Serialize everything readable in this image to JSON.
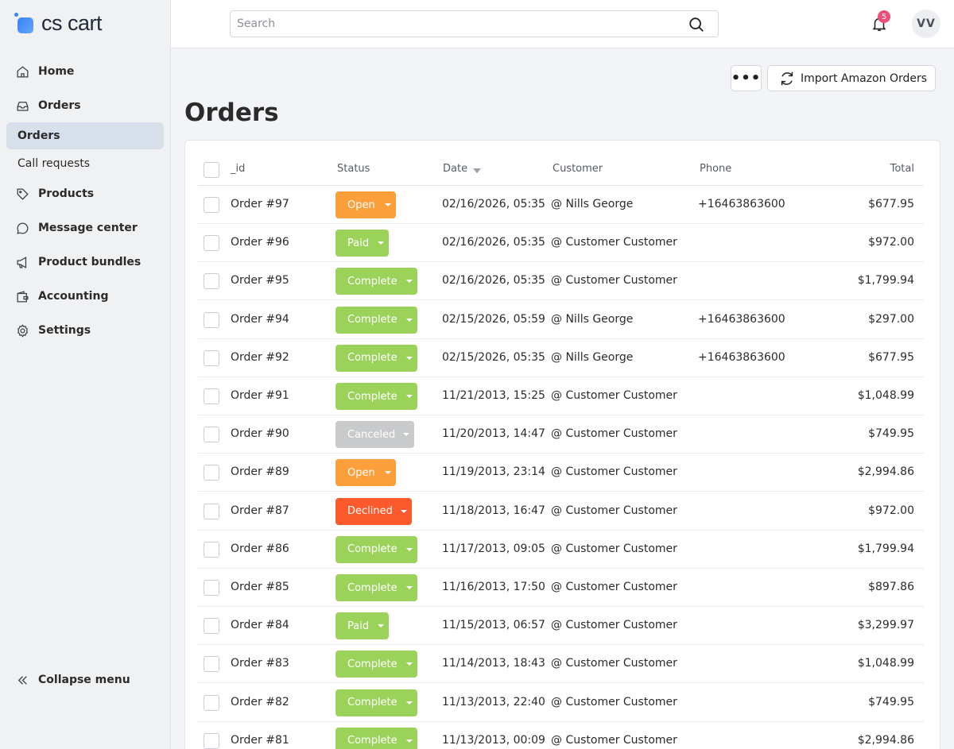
{
  "app": {
    "logo_text": "cs cart"
  },
  "sidebar": {
    "items": [
      {
        "label": "Home",
        "icon": "home-icon"
      },
      {
        "label": "Orders",
        "icon": "inbox-icon"
      },
      {
        "label": "Products",
        "icon": "tag-icon"
      },
      {
        "label": "Message center",
        "icon": "message-icon"
      },
      {
        "label": "Product bundles",
        "icon": "megaphone-icon"
      },
      {
        "label": "Accounting",
        "icon": "wallet-icon"
      },
      {
        "label": "Settings",
        "icon": "gear-icon"
      }
    ],
    "subitems": [
      {
        "label": "Orders",
        "active": true
      },
      {
        "label": "Call requests",
        "active": false
      }
    ],
    "collapse_label": "Collapse menu"
  },
  "topbar": {
    "search_placeholder": "Search",
    "notifications_count": "5",
    "avatar_initials": "VV"
  },
  "page": {
    "title": "Orders",
    "more_label": "•••",
    "import_label": "Import Amazon Orders"
  },
  "table": {
    "headers": {
      "id": "_id",
      "status": "Status",
      "date": "Date",
      "customer": "Customer",
      "phone": "Phone",
      "total": "Total"
    },
    "status_colors": {
      "Open": "#fd9f3a",
      "Paid": "#9bd35a",
      "Complete": "#9bd35a",
      "Canceled": "#c9cacc",
      "Declined": "#fc5a2c"
    },
    "rows": [
      {
        "id": "Order #97",
        "status": "Open",
        "date": "02/16/2026, 05:35",
        "customer": "@ Nills George",
        "phone": "+16463863600",
        "total": "$677.95"
      },
      {
        "id": "Order #96",
        "status": "Paid",
        "date": "02/16/2026, 05:35",
        "customer": "@ Customer Customer",
        "phone": "",
        "total": "$972.00"
      },
      {
        "id": "Order #95",
        "status": "Complete",
        "date": "02/16/2026, 05:35",
        "customer": "@ Customer Customer",
        "phone": "",
        "total": "$1,799.94"
      },
      {
        "id": "Order #94",
        "status": "Complete",
        "date": "02/15/2026, 05:59",
        "customer": "@ Nills George",
        "phone": "+16463863600",
        "total": "$297.00"
      },
      {
        "id": "Order #92",
        "status": "Complete",
        "date": "02/15/2026, 05:35",
        "customer": "@ Nills George",
        "phone": "+16463863600",
        "total": "$677.95"
      },
      {
        "id": "Order #91",
        "status": "Complete",
        "date": "11/21/2013, 15:25",
        "customer": "@ Customer Customer",
        "phone": "",
        "total": "$1,048.99"
      },
      {
        "id": "Order #90",
        "status": "Canceled",
        "date": "11/20/2013, 14:47",
        "customer": "@ Customer Customer",
        "phone": "",
        "total": "$749.95"
      },
      {
        "id": "Order #89",
        "status": "Open",
        "date": "11/19/2013, 23:14",
        "customer": "@ Customer Customer",
        "phone": "",
        "total": "$2,994.86"
      },
      {
        "id": "Order #87",
        "status": "Declined",
        "date": "11/18/2013, 16:47",
        "customer": "@ Customer Customer",
        "phone": "",
        "total": "$972.00"
      },
      {
        "id": "Order #86",
        "status": "Complete",
        "date": "11/17/2013, 09:05",
        "customer": "@ Customer Customer",
        "phone": "",
        "total": "$1,799.94"
      },
      {
        "id": "Order #85",
        "status": "Complete",
        "date": "11/16/2013, 17:50",
        "customer": "@ Customer Customer",
        "phone": "",
        "total": "$897.86"
      },
      {
        "id": "Order #84",
        "status": "Paid",
        "date": "11/15/2013, 06:57",
        "customer": "@ Customer Customer",
        "phone": "",
        "total": "$3,299.97"
      },
      {
        "id": "Order #83",
        "status": "Complete",
        "date": "11/14/2013, 18:43",
        "customer": "@ Customer Customer",
        "phone": "",
        "total": "$1,048.99"
      },
      {
        "id": "Order #82",
        "status": "Complete",
        "date": "11/13/2013, 22:40",
        "customer": "@ Customer Customer",
        "phone": "",
        "total": "$749.95"
      },
      {
        "id": "Order #81",
        "status": "Complete",
        "date": "11/13/2013, 00:09",
        "customer": "@ Customer Customer",
        "phone": "",
        "total": "$2,994.86"
      }
    ]
  }
}
